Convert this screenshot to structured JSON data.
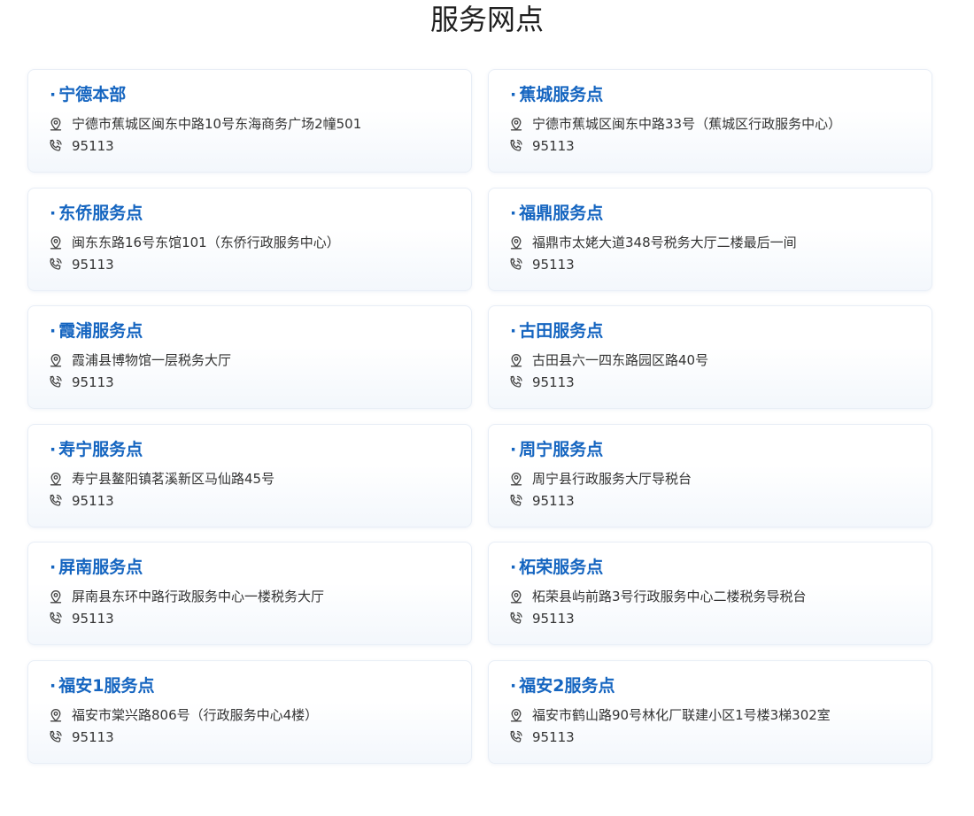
{
  "page": {
    "title": "服务网点"
  },
  "icons": {
    "address": "location-pin-icon",
    "phone": "phone-icon"
  },
  "colors": {
    "title_blue": "#1565c0",
    "card_border": "#e8eef6"
  },
  "cards": [
    {
      "name": "宁德本部",
      "address": "宁德市蕉城区闽东中路10号东海商务广场2幢501",
      "phone": "95113"
    },
    {
      "name": "蕉城服务点",
      "address": "宁德市蕉城区闽东中路33号（蕉城区行政服务中心）",
      "phone": "95113"
    },
    {
      "name": "东侨服务点",
      "address": "闽东东路16号东馆101（东侨行政服务中心）",
      "phone": "95113"
    },
    {
      "name": "福鼎服务点",
      "address": "福鼎市太姥大道348号税务大厅二楼最后一间",
      "phone": "95113"
    },
    {
      "name": "霞浦服务点",
      "address": "霞浦县博物馆一层税务大厅",
      "phone": "95113"
    },
    {
      "name": "古田服务点",
      "address": "古田县六一四东路园区路40号",
      "phone": "95113"
    },
    {
      "name": "寿宁服务点",
      "address": "寿宁县鳌阳镇茗溪新区马仙路45号",
      "phone": "95113"
    },
    {
      "name": "周宁服务点",
      "address": "周宁县行政服务大厅导税台",
      "phone": "95113"
    },
    {
      "name": "屏南服务点",
      "address": "屏南县东环中路行政服务中心一楼税务大厅",
      "phone": "95113"
    },
    {
      "name": "柘荣服务点",
      "address": "柘荣县屿前路3号行政服务中心二楼税务导税台",
      "phone": "95113"
    },
    {
      "name": "福安1服务点",
      "address": "福安市棠兴路806号（行政服务中心4楼）",
      "phone": "95113"
    },
    {
      "name": "福安2服务点",
      "address": "福安市鹤山路90号林化厂联建小区1号楼3梯302室",
      "phone": "95113"
    }
  ]
}
